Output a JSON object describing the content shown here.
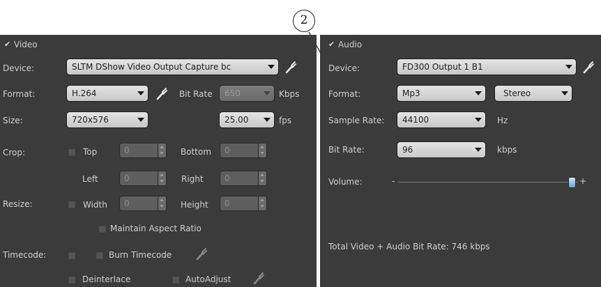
{
  "callout": {
    "number": "2"
  },
  "video": {
    "header": "Video",
    "device_label": "Device:",
    "device_value": "SLTM DShow Video Output Capture bc",
    "format_label": "Format:",
    "format_value": "H.264",
    "bitrate_label": "Bit Rate",
    "bitrate_value": "650",
    "bitrate_unit": "Kbps",
    "size_label": "Size:",
    "size_value": "720x576",
    "fps_value": "25.00",
    "fps_unit": "fps",
    "crop_label": "Crop:",
    "top_label": "Top",
    "top_value": "0",
    "bottom_label": "Bottom",
    "bottom_value": "0",
    "left_label": "Left",
    "left_value": "0",
    "right_label": "Right",
    "right_value": "0",
    "resize_label": "Resize:",
    "width_label": "Width",
    "width_value": "0",
    "height_label": "Height",
    "height_value": "0",
    "maintain_label": "Maintain Aspect Ratio",
    "timecode_label": "Timecode:",
    "burn_label": "Burn Timecode",
    "deinterlace_label": "Deinterlace",
    "autoadjust_label": "AutoAdjust"
  },
  "audio": {
    "header": "Audio",
    "device_label": "Device:",
    "device_value": "FD300 Output 1 B1",
    "format_label": "Format:",
    "format_value": "Mp3",
    "channels_value": "Stereo",
    "samplerate_label": "Sample Rate:",
    "samplerate_value": "44100",
    "samplerate_unit": "Hz",
    "bitrate_label": "Bit Rate:",
    "bitrate_value": "96",
    "bitrate_unit": "kbps",
    "volume_label": "Volume:",
    "volume_minus": "-",
    "volume_plus": "+",
    "volume_level": 1.0,
    "total_label": "Total Video + Audio Bit Rate: 746 kbps"
  },
  "colors": {
    "panel": "#3b3b3b",
    "field": "#ededed",
    "knob": "#6a9cd8"
  }
}
